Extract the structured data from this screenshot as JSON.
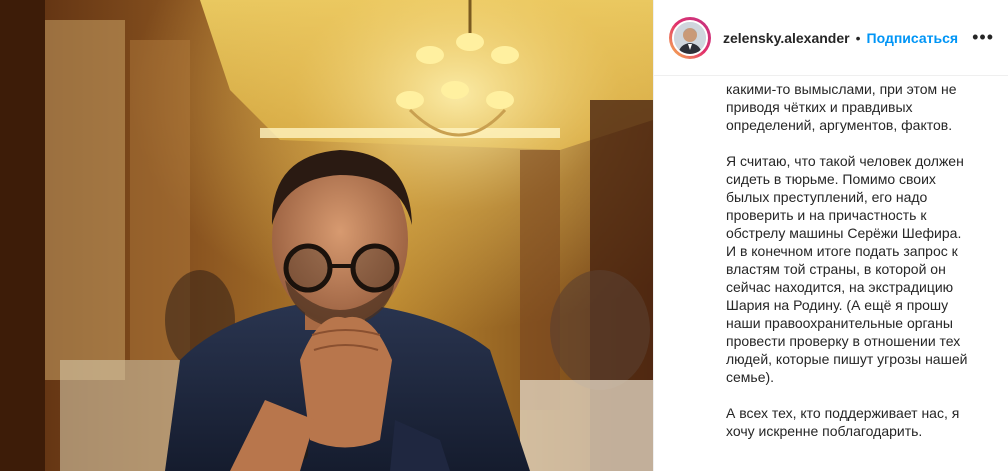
{
  "post": {
    "photo_alt": "",
    "header": {
      "username": "zelensky.alexander",
      "separator": "•",
      "follow_label": "Подписаться"
    },
    "caption": "какими-то вымыслами, при этом не\nприводя чётких и правдивых\nопределений, аргументов, фактов.\n\nЯ считаю, что такой человек должен\nсидеть в тюрьме. Помимо своих\nбылых преступлений, его надо\nпроверить и на причастность к\nобстрелу машины Серёжи Шефира.\nИ в конечном итоге подать запрос к\nвластям той страны, в которой он\nсейчас находится, на экстрадицию\nШария на Родину. (А ещё я прошу\nнаши правоохранительные органы\nпровести проверку в отношении тех\nлюдей, которые пишут угрозы нашей\nсемье).\n\nА всех тех, кто поддерживает нас, я\nхочу искренне поблагодарить."
  },
  "icons": {
    "more": "more-options-icon",
    "avatar": "profile-avatar"
  },
  "colors": {
    "accent": "#0095f6",
    "text": "#262626",
    "border": "#efefef"
  }
}
